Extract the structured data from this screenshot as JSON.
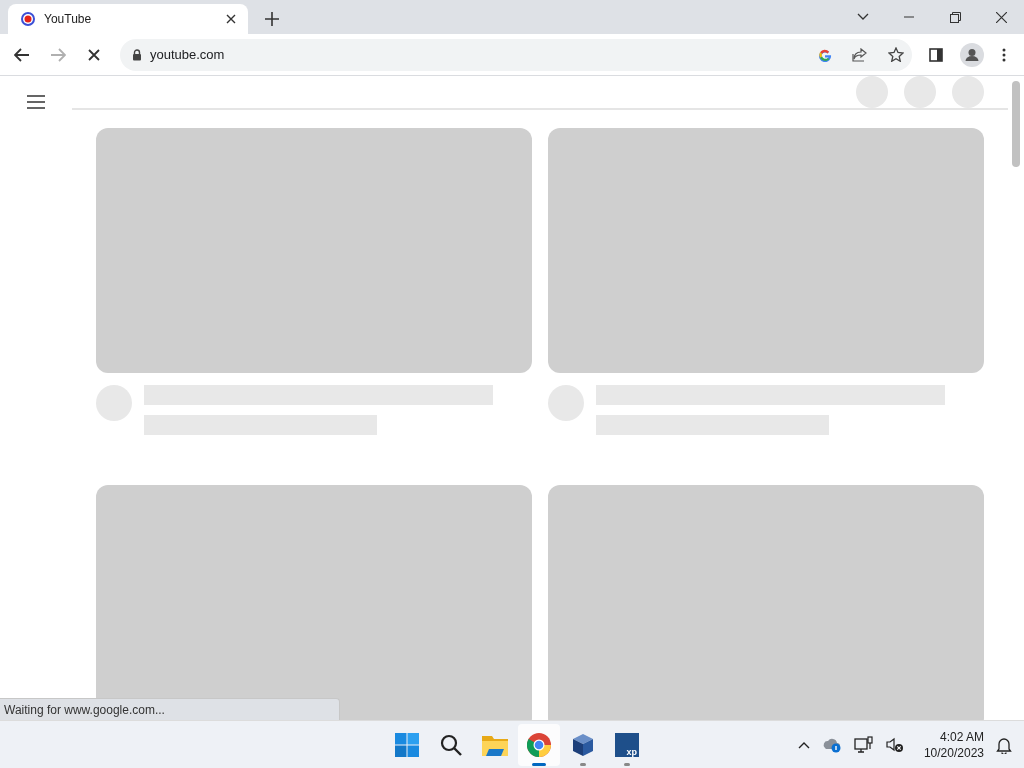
{
  "tabs": [
    {
      "title": "YouTube",
      "selected": true
    }
  ],
  "toolbar": {
    "url": "youtube.com",
    "loading": true,
    "forward_disabled": true
  },
  "feed": {
    "cards": [
      {
        "kind": "skeleton"
      },
      {
        "kind": "skeleton"
      },
      {
        "kind": "thumbnail"
      },
      {
        "kind": "thumbnail"
      }
    ]
  },
  "status_bubble": "Waiting for www.google.com...",
  "taskbar": {
    "apps": [
      {
        "kind": "start",
        "selected": false,
        "running": false
      },
      {
        "kind": "search",
        "selected": false,
        "running": false
      },
      {
        "kind": "files",
        "selected": false,
        "running": false
      },
      {
        "kind": "chrome",
        "selected": true,
        "running": true
      },
      {
        "kind": "vbox",
        "selected": false,
        "running": true
      },
      {
        "kind": "xp",
        "badge": "xp",
        "selected": false,
        "running": true
      }
    ],
    "time": "4:02 AM",
    "date": "10/20/2023"
  }
}
